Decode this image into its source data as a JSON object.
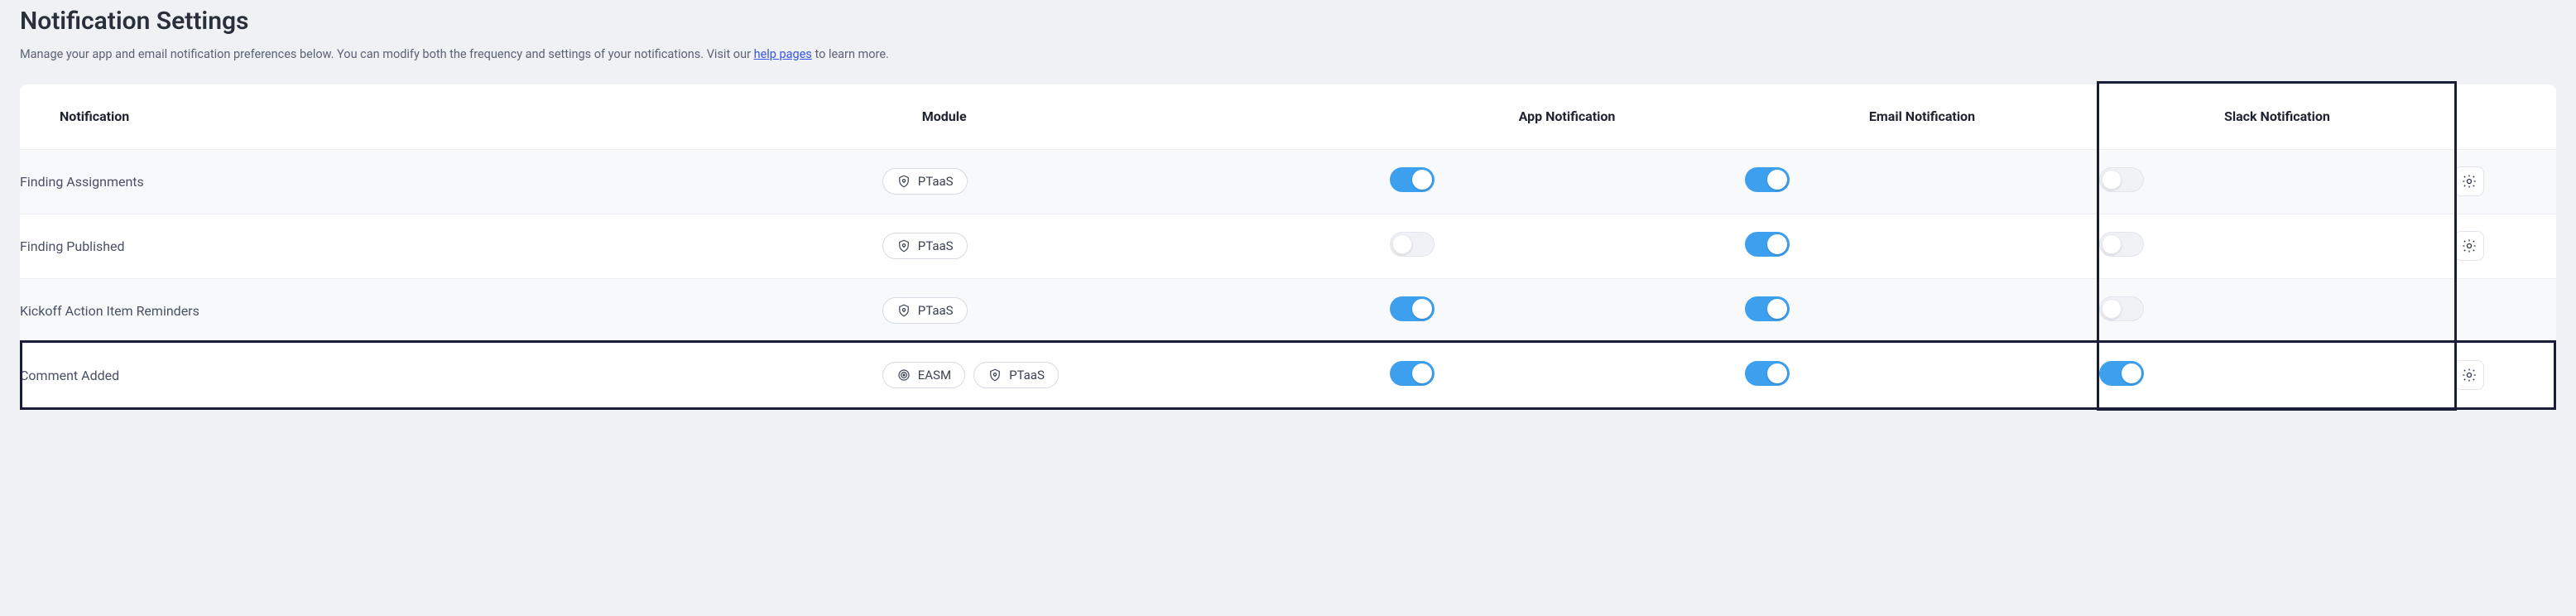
{
  "header": {
    "title": "Notification Settings",
    "desc_before": "Manage your app and email notification preferences below. You can modify both the frequency and settings of your notifications. Visit our ",
    "link_text": "help pages",
    "desc_after": " to learn more."
  },
  "columns": {
    "notification": "Notification",
    "module": "Module",
    "app": "App Notification",
    "email": "Email Notification",
    "slack": "Slack Notification"
  },
  "modules": {
    "ptaas": "PTaaS",
    "easm": "EASM"
  },
  "rows": [
    {
      "name": "Finding Assignments",
      "modules": [
        "ptaas"
      ],
      "app": true,
      "email": true,
      "slack": false,
      "gear": true,
      "alt": true
    },
    {
      "name": "Finding Published",
      "modules": [
        "ptaas"
      ],
      "app": false,
      "email": true,
      "slack": false,
      "gear": true,
      "alt": false
    },
    {
      "name": "Kickoff Action Item Reminders",
      "modules": [
        "ptaas"
      ],
      "app": true,
      "email": true,
      "slack": false,
      "gear": false,
      "alt": true
    },
    {
      "name": "Comment Added",
      "modules": [
        "easm",
        "ptaas"
      ],
      "app": true,
      "email": true,
      "slack": true,
      "gear": true,
      "alt": false
    }
  ],
  "highlight": {
    "column": "slack",
    "row_index": 3
  }
}
